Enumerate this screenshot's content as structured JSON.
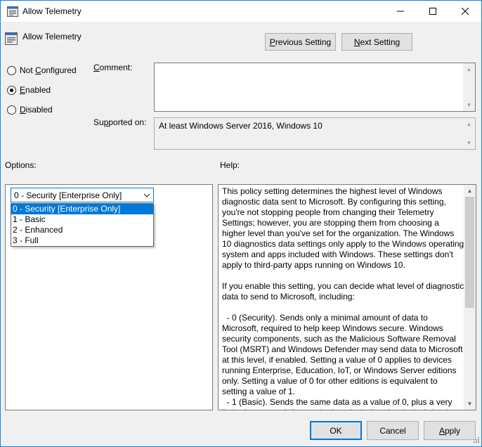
{
  "window": {
    "title": "Allow Telemetry",
    "accent": "#0078d7"
  },
  "header": {
    "title": "Allow Telemetry",
    "previous_label_u": "P",
    "previous_label_rest": "revious Setting",
    "next_label_u": "N",
    "next_label_rest": "ext Setting"
  },
  "state": {
    "options": [
      {
        "u": "C",
        "pre": "Not ",
        "post": "onfigured",
        "checked": false
      },
      {
        "u": "E",
        "pre": "",
        "post": "nabled",
        "checked": true
      },
      {
        "u": "D",
        "pre": "",
        "post": "isabled",
        "checked": false
      }
    ]
  },
  "labels": {
    "comment_u": "C",
    "comment_rest": "omment:",
    "supported_pre": "Su",
    "supported_u": "p",
    "supported_rest": "ported on:",
    "options": "Options:",
    "help": "Help:"
  },
  "comment": {
    "value": ""
  },
  "supported_on": "At least Windows Server 2016, Windows 10",
  "options_panel": {
    "selected": "0 - Security [Enterprise Only]",
    "items": [
      "0 - Security [Enterprise Only]",
      "1 - Basic",
      "2 - Enhanced",
      "3 - Full"
    ]
  },
  "help_text": "This policy setting determines the highest level of Windows diagnostic data sent to Microsoft. By configuring this setting, you're not stopping people from changing their Telemetry Settings; however, you are stopping them from choosing a higher level than you've set for the organization. The Windows 10 diagnostics data settings only apply to the Windows operating system and apps included with Windows. These settings don't apply to third-party apps running on Windows 10.\n\nIf you enable this setting, you can decide what level of diagnostic data to send to Microsoft, including:\n\n  - 0 (Security). Sends only a minimal amount of data to Microsoft, required to help keep Windows secure. Windows security components, such as the Malicious Software Removal Tool (MSRT) and Windows Defender may send data to Microsoft at this level, if enabled. Setting a value of 0 applies to devices running Enterprise, Education, IoT, or Windows Server editions only. Setting a value of 0 for other editions is equivalent to setting a value of 1.\n  - 1 (Basic). Sends the same data as a value of 0, plus a very limited amount of diagnostic data, including the device's basic",
  "footer": {
    "ok": "OK",
    "cancel": "Cancel",
    "apply_u": "A",
    "apply_rest": "pply"
  },
  "icons": [
    "app-policy-icon",
    "minimize-icon",
    "maximize-icon",
    "close-icon",
    "policy-setting-icon",
    "chevron-down-icon",
    "scroll-up-icon",
    "scroll-down-icon",
    "size-grip-icon"
  ]
}
